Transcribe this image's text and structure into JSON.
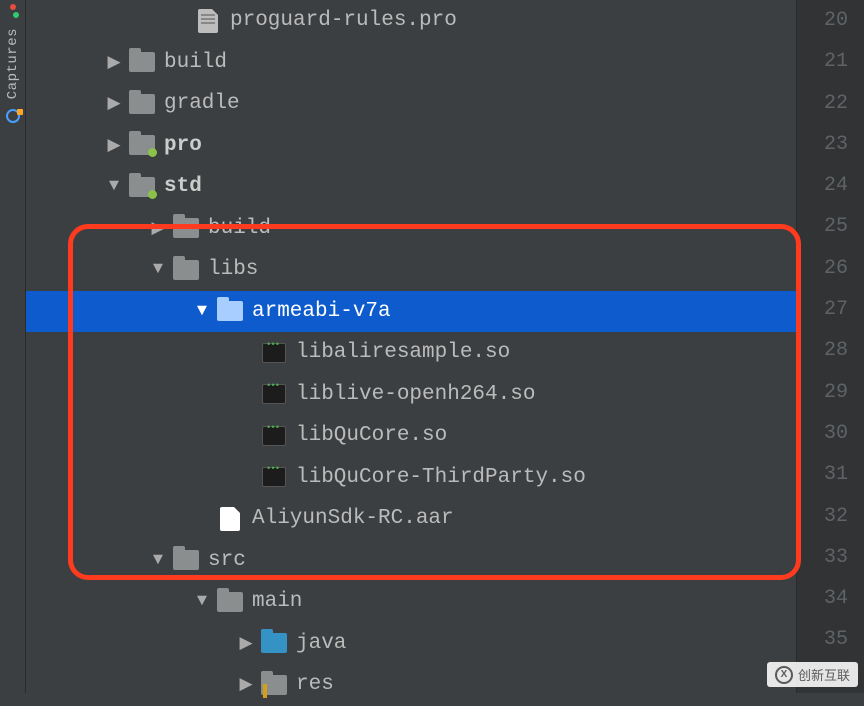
{
  "sidebar": {
    "captures_label": "Captures"
  },
  "tree": {
    "row0": "proguard-rules.pro",
    "row1": "build",
    "row2": "gradle",
    "row3": "pro",
    "row4": "std",
    "row5": "build",
    "row6": "libs",
    "row7": "armeabi-v7a",
    "row8": "libaliresample.so",
    "row9": "liblive-openh264.so",
    "row10": "libQuCore.so",
    "row11": "libQuCore-ThirdParty.so",
    "row12": "AliyunSdk-RC.aar",
    "row13": "src",
    "row14": "main",
    "row15": "java",
    "row16": "res"
  },
  "gutter": {
    "start": 20,
    "end": 35
  },
  "watermark": {
    "text": "创新互联"
  }
}
